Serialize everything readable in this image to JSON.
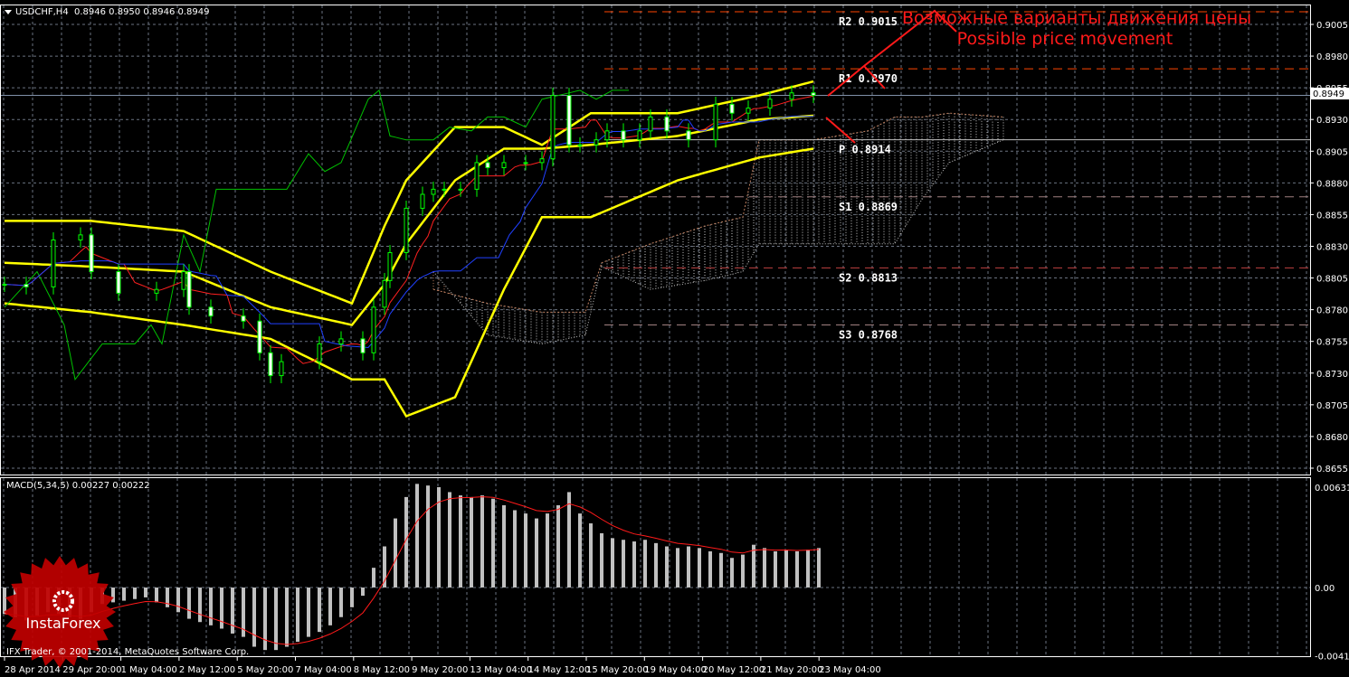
{
  "header": {
    "symbol_label": "USDCHF,H4",
    "ohlc": "0.8946 0.8950 0.8946 0.8949"
  },
  "macd_header": "MACD(5,34,5) 0.00227 0.00222",
  "copyright": "IFX Trader, © 2001-2014, MetaQuotes Software Corp.",
  "logo_text": "InstaForex",
  "annotation": {
    "ru": "Возможные варианты движения цены",
    "en": "Possible price movement",
    "color": "#ff1a1a"
  },
  "current_price": {
    "value": 0.8949,
    "label": "0.8949"
  },
  "chart_data": [
    {
      "type": "candlestick",
      "title": "USDCHF,H4",
      "ylim": [
        0.8643,
        0.903
      ],
      "y_ticks": [
        "0.9005",
        "0.8980",
        "0.8955",
        "0.8930",
        "0.8905",
        "0.8880",
        "0.8855",
        "0.8830",
        "0.8805",
        "0.8780",
        "0.8755",
        "0.8730",
        "0.8705",
        "0.8680",
        "0.8655"
      ],
      "x_ticks": [
        "28 Apr 2014",
        "29 Apr 20:00",
        "1 May 04:00",
        "2 May 12:00",
        "5 May 20:00",
        "7 May 04:00",
        "8 May 12:00",
        "9 May 20:00",
        "13 May 04:00",
        "14 May 12:00",
        "15 May 20:00",
        "19 May 04:00",
        "20 May 12:00",
        "21 May 20:00",
        "23 May 04:00"
      ],
      "bars": [
        0,
        4,
        9,
        14,
        16,
        21,
        28,
        33,
        34,
        38,
        44,
        47,
        49,
        51,
        58,
        62,
        66,
        68,
        70,
        71,
        74,
        77,
        79,
        81,
        84,
        87,
        89,
        92,
        96,
        99,
        101,
        104,
        106,
        109,
        111,
        114,
        117,
        119,
        122,
        126,
        131,
        134,
        137,
        141,
        145,
        149
      ],
      "close": [
        0.88,
        0.8798,
        0.8835,
        0.8839,
        0.881,
        0.8793,
        0.8796,
        0.881,
        0.8782,
        0.8775,
        0.8771,
        0.8746,
        0.8728,
        0.8739,
        0.8753,
        0.8757,
        0.8746,
        0.8782,
        0.8803,
        0.8825,
        0.886,
        0.8871,
        0.8875,
        0.8875,
        0.8875,
        0.8896,
        0.8892,
        0.8896,
        0.8896,
        0.8899,
        0.8949,
        0.891,
        0.891,
        0.8914,
        0.8921,
        0.8914,
        0.8921,
        0.8932,
        0.8921,
        0.8914,
        0.8942,
        0.8935,
        0.8939,
        0.8946,
        0.8951,
        0.8949
      ],
      "bollinger": {
        "bars": [
          0,
          16,
          33,
          49,
          64,
          70,
          74,
          83,
          92,
          99,
          108,
          124,
          139,
          149
        ],
        "upper": [
          0.885,
          0.885,
          0.8842,
          0.881,
          0.8785,
          0.8846,
          0.8882,
          0.8924,
          0.8924,
          0.891,
          0.8935,
          0.8935,
          0.8949,
          0.896
        ],
        "middle": [
          0.8817,
          0.8814,
          0.881,
          0.8782,
          0.8768,
          0.88,
          0.8832,
          0.8882,
          0.8907,
          0.8907,
          0.891,
          0.8917,
          0.893,
          0.8933
        ],
        "lower": [
          0.8785,
          0.8778,
          0.8768,
          0.8757,
          0.8725,
          0.8725,
          0.8696,
          0.8711,
          0.8796,
          0.8853,
          0.8853,
          0.8882,
          0.89,
          0.8907
        ]
      },
      "lagging_span": {
        "bars": [
          0,
          6,
          11,
          13,
          18,
          24,
          27,
          29,
          33,
          36,
          39,
          46,
          52,
          56,
          59,
          62,
          67,
          69,
          71,
          74,
          79,
          82,
          86,
          89,
          92,
          96,
          99,
          106,
          109,
          112,
          115
        ],
        "values": [
          0.8782,
          0.881,
          0.8768,
          0.8725,
          0.8753,
          0.8753,
          0.8768,
          0.8753,
          0.8839,
          0.881,
          0.8875,
          0.8875,
          0.8875,
          0.8903,
          0.8889,
          0.8896,
          0.8946,
          0.8953,
          0.8917,
          0.8914,
          0.8914,
          0.8924,
          0.8921,
          0.8932,
          0.8932,
          0.8924,
          0.8946,
          0.8953,
          0.8946,
          0.8953,
          0.8953
        ]
      },
      "cloud": {
        "bars": [
          79,
          89,
          99,
          107,
          110,
          119,
          129,
          136,
          139,
          149,
          159,
          164,
          169,
          174,
          184
        ],
        "span_a": [
          0.8796,
          0.8785,
          0.8778,
          0.8778,
          0.8817,
          0.8832,
          0.8846,
          0.8853,
          0.8914,
          0.8914,
          0.8921,
          0.8932,
          0.8932,
          0.8935,
          0.8932
        ],
        "span_b": [
          0.881,
          0.876,
          0.8753,
          0.876,
          0.8814,
          0.8796,
          0.8803,
          0.881,
          0.8832,
          0.8832,
          0.8832,
          0.8832,
          0.8867,
          0.8896,
          0.8914
        ]
      },
      "pivots": [
        {
          "name": "R2",
          "value": 0.9015,
          "label": "R2  0.9015",
          "color": "#ff4500"
        },
        {
          "name": "R1",
          "value": 0.897,
          "label": "R1  0.8970",
          "color": "#ff4500"
        },
        {
          "name": "P",
          "value": 0.8914,
          "label": "P  0.8914",
          "color": "#c0c0c0"
        },
        {
          "name": "S1",
          "value": 0.8869,
          "label": "S1  0.8869",
          "color": "#a08080"
        },
        {
          "name": "S2",
          "value": 0.8813,
          "label": "S2  0.8813",
          "color": "#c04040"
        },
        {
          "name": "S3",
          "value": 0.8768,
          "label": "S3  0.8768",
          "color": "#a08080"
        }
      ]
    },
    {
      "type": "bar",
      "title": "MACD(5,34,5)",
      "ylim": [
        -0.00416,
        0.00631
      ],
      "y_ticks": [
        "0.00631",
        "0.00",
        "-0.00416"
      ],
      "bar_step": 2,
      "histogram": [
        -0.0016,
        -0.0018,
        -0.002,
        -0.0017,
        -0.0015,
        -0.0016,
        -0.0018,
        -0.0019,
        -0.0015,
        -0.001,
        -0.0009,
        -0.0008,
        -0.0007,
        -0.0006,
        -0.0009,
        -0.0012,
        -0.0015,
        -0.0019,
        -0.0021,
        -0.0023,
        -0.0025,
        -0.0028,
        -0.003,
        -0.0036,
        -0.0038,
        -0.0038,
        -0.0036,
        -0.0033,
        -0.003,
        -0.0027,
        -0.0023,
        -0.0018,
        -0.0012,
        -0.0005,
        0.0012,
        0.0025,
        0.0042,
        0.0055,
        0.0063,
        0.0062,
        0.0061,
        0.0058,
        0.0056,
        0.0055,
        0.0056,
        0.0054,
        0.005,
        0.0047,
        0.0045,
        0.0042,
        0.0045,
        0.005,
        0.0058,
        0.0045,
        0.0039,
        0.0033,
        0.003,
        0.0029,
        0.0028,
        0.0029,
        0.0027,
        0.0025,
        0.0024,
        0.0025,
        0.0024,
        0.0022,
        0.0021,
        0.0018,
        0.002,
        0.0026,
        0.0024,
        0.0022,
        0.0023,
        0.0022,
        0.0023,
        0.0024
      ]
    }
  ]
}
